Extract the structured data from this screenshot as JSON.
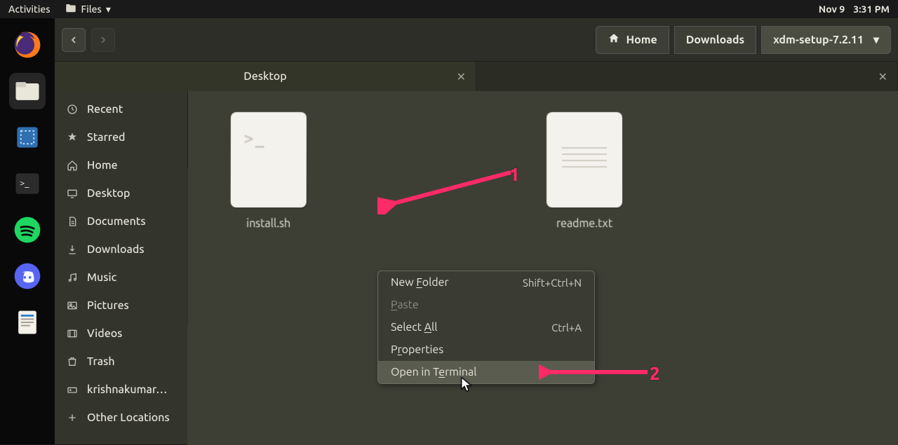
{
  "topbar": {
    "activities": "Activities",
    "files_label": "Files",
    "date": "Nov 9",
    "time": "3:31 PM"
  },
  "dock": {
    "items": [
      {
        "name": "firefox"
      },
      {
        "name": "files"
      },
      {
        "name": "screenshot"
      },
      {
        "name": "terminal"
      },
      {
        "name": "spotify"
      },
      {
        "name": "discord"
      },
      {
        "name": "libreoffice"
      }
    ]
  },
  "fm": {
    "path": {
      "home": "Home",
      "downloads": "Downloads",
      "folder": "xdm-setup-7.2.11"
    },
    "tabs": [
      {
        "label": "Desktop",
        "active": true
      },
      {
        "label": "",
        "active": false
      }
    ],
    "sidebar": [
      {
        "icon": "clock",
        "label": "Recent"
      },
      {
        "icon": "star",
        "label": "Starred"
      },
      {
        "icon": "home",
        "label": "Home"
      },
      {
        "icon": "desktop",
        "label": "Desktop"
      },
      {
        "icon": "documents",
        "label": "Documents"
      },
      {
        "icon": "downloads",
        "label": "Downloads"
      },
      {
        "icon": "music",
        "label": "Music"
      },
      {
        "icon": "pictures",
        "label": "Pictures"
      },
      {
        "icon": "videos",
        "label": "Videos"
      },
      {
        "icon": "trash",
        "label": "Trash"
      },
      {
        "icon": "drive",
        "label": "krishnakumar…"
      },
      {
        "icon": "plus",
        "label": "Other Locations"
      }
    ],
    "files": [
      {
        "name": "install.sh",
        "type": "sh"
      },
      {
        "name": "readme.txt",
        "type": "txt"
      }
    ],
    "context_menu": [
      {
        "label_pre": "New ",
        "label_u": "F",
        "label_post": "older",
        "shortcut": "Shift+Ctrl+N",
        "disabled": false
      },
      {
        "label_pre": "",
        "label_u": "P",
        "label_post": "aste",
        "shortcut": "",
        "disabled": true
      },
      {
        "label_pre": "Select ",
        "label_u": "A",
        "label_post": "ll",
        "shortcut": "Ctrl+A",
        "disabled": false
      },
      {
        "label_pre": "P",
        "label_u": "r",
        "label_post": "operties",
        "shortcut": "",
        "disabled": false
      },
      {
        "label_pre": "Open in T",
        "label_u": "e",
        "label_post": "rminal",
        "shortcut": "",
        "disabled": false,
        "hover": true
      }
    ]
  },
  "annotations": {
    "a1": "1",
    "a2": "2"
  }
}
